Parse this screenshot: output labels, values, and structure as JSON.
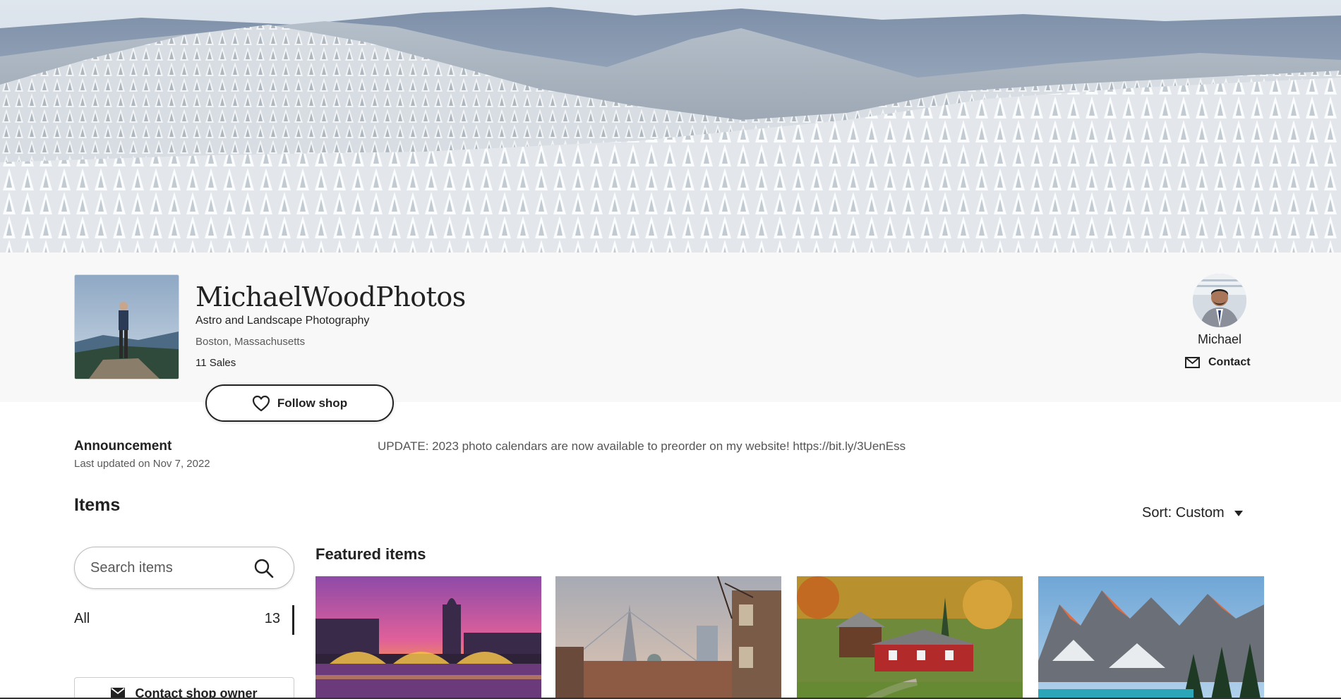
{
  "shop": {
    "name": "MichaelWoodPhotos",
    "tagline": "Astro and Landscape Photography",
    "location": "Boston, Massachusetts",
    "sales": "11 Sales",
    "follow_label": "Follow shop"
  },
  "owner": {
    "name": "Michael",
    "contact_label": "Contact"
  },
  "announcement": {
    "title": "Announcement",
    "updated": "Last updated on Nov 7, 2022",
    "text": "UPDATE: 2023 photo calendars are now available to preorder on my website! https://bit.ly/3UenEss"
  },
  "items": {
    "title": "Items",
    "sort_label": "Sort: Custom",
    "search_placeholder": "Search items",
    "sections": [
      {
        "label": "All",
        "count": "13"
      }
    ],
    "contact_owner_label": "Contact shop owner",
    "featured_title": "Featured items"
  },
  "icons": {
    "follow": "heart-icon",
    "contact": "envelope-icon",
    "search": "search-icon",
    "sort": "caret-down-icon"
  }
}
